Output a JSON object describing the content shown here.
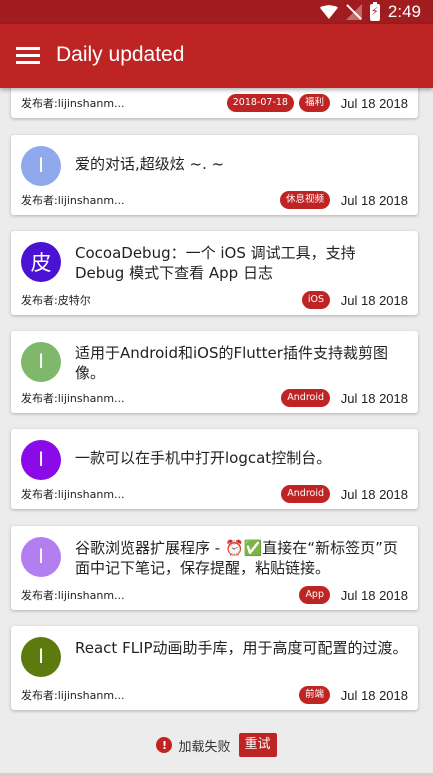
{
  "status_bar": {
    "time": "2:49",
    "battery_label": "⚡",
    "icons": [
      "wifi-icon",
      "no-signal-icon",
      "battery-charging-icon"
    ]
  },
  "app_bar": {
    "title": "Daily updated",
    "menu_icon": "hamburger-menu-icon"
  },
  "colors": {
    "primary": "#bf2424",
    "status_bar": "#a01c1e"
  },
  "feed": {
    "items": [
      {
        "description": "",
        "avatar_letter": "",
        "avatar_color": "",
        "author": "发布者:lijinshanm...",
        "tags": [
          "2018-07-18",
          "福利"
        ],
        "date": "Jul 18 2018"
      },
      {
        "description": "爱的对话,超级炫 ~. ~",
        "avatar_letter": "I",
        "avatar_color": "#90a8ec",
        "author": "发布者:lijinshanm...",
        "tags": [
          "休息视频"
        ],
        "date": "Jul 18 2018"
      },
      {
        "description": "CocoaDebug：一个 iOS 调试工具，支持 Debug 模式下查看 App 日志",
        "avatar_letter": "皮",
        "avatar_color": "#4a12d2",
        "author": "发布者:皮特尔",
        "tags": [
          "iOS"
        ],
        "date": "Jul 18 2018"
      },
      {
        "description": "适用于Android和iOS的Flutter插件支持裁剪图像。",
        "avatar_letter": "I",
        "avatar_color": "#7fb86a",
        "author": "发布者:lijinshanm...",
        "tags": [
          "Android"
        ],
        "date": "Jul 18 2018"
      },
      {
        "description": "一款可以在手机中打开logcat控制台。",
        "avatar_letter": "I",
        "avatar_color": "#8a0ae8",
        "author": "发布者:lijinshanm...",
        "tags": [
          "Android"
        ],
        "date": "Jul 18 2018"
      },
      {
        "description": "谷歌浏览器扩展程序 - ⏰✅直接在“新标签页”页面中记下笔记，保存提醒，粘贴链接。",
        "avatar_letter": "I",
        "avatar_color": "#b27ef0",
        "author": "发布者:lijinshanm...",
        "tags": [
          "App"
        ],
        "date": "Jul 18 2018"
      },
      {
        "description": "React FLIP动画助手库，用于高度可配置的过渡。",
        "avatar_letter": "I",
        "avatar_color": "#5c7a0e",
        "author": "发布者:lijinshanm...",
        "tags": [
          "前端"
        ],
        "date": "Jul 18 2018"
      }
    ]
  },
  "footer": {
    "error_icon": "!",
    "error_text": "加载失败",
    "retry_label": "重试"
  }
}
